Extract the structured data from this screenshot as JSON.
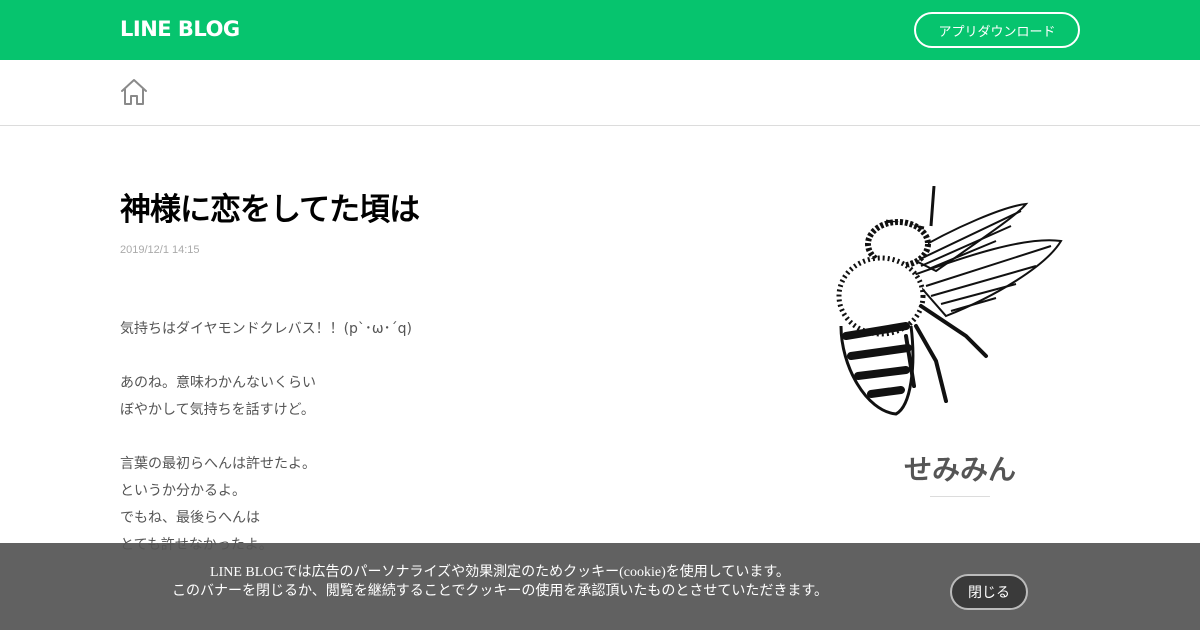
{
  "header": {
    "logo": "LINE BLOG",
    "app_download_label": "アプリダウンロード"
  },
  "nav": {
    "home_icon": "home-icon"
  },
  "post": {
    "title": "神様に恋をしてた頃は",
    "date": "2019/12/1 14:15",
    "lines": [
      "気持ちはダイヤモンドクレバス！！(p`･ω･´q)",
      "",
      "あのね。意味わかんないくらい",
      "ぼやかして気持ちを話すけど。",
      "",
      "言葉の最初らへんは許せたよ。",
      "というか分かるよ。",
      "でもね、最後らへんは",
      "とても許せなかったよ。"
    ]
  },
  "sidebar": {
    "author_name": "せみみん",
    "avatar_icon": "bee-illustration"
  },
  "cookie_banner": {
    "line1": "LINE BLOGでは広告のパーソナライズや効果測定のためクッキー(cookie)を使用しています。",
    "line2": "このバナーを閉じるか、閲覧を継続することでクッキーの使用を承認頂いたものとさせていただきます。",
    "close_label": "閉じる"
  },
  "colors": {
    "brand_green": "#06c46e",
    "banner_bg": "#555555"
  }
}
